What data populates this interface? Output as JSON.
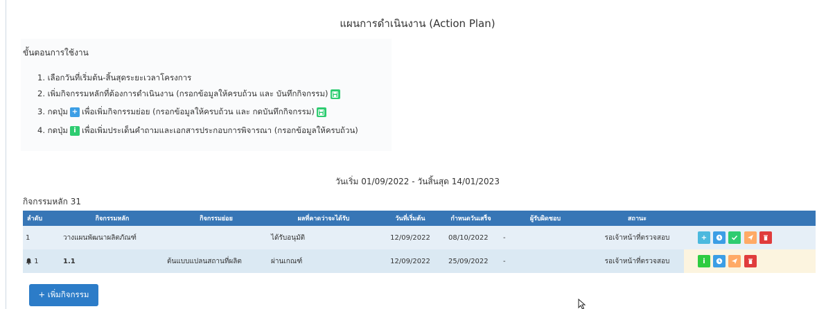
{
  "page": {
    "title": "แผนการดำเนินงาน (Action Plan)"
  },
  "instructions": {
    "heading": "ขั้นตอนการใช้งาน",
    "step1": "1. เลือกวันที่เริ่มต้น-สิ้นสุดระยะเวลาโครงการ",
    "step2": "2. เพิ่มกิจกรรมหลักที่ต้องการดำเนินงาน (กรอกข้อมูลให้ครบถ้วน และ บันทึกกิจกรรม)",
    "step3_prefix": "3. กดปุ่ม",
    "step3_suffix": "เพื่อเพิ่มกิจกรรมย่อย (กรอกข้อมูลให้ครบถ้วน และ กดบันทึกกิจกรรม)",
    "step4_prefix": "4. กดปุ่ม",
    "step4_suffix": "เพื่อเพิ่มประเด็นคำถามและเอกสารประกอบการพิจารณา (กรอกข้อมูลให้ครบถ้วน)",
    "icon_save": "floppy-disk-icon",
    "icon_plus": "plus-icon",
    "icon_info": "info-icon"
  },
  "date_range": "วันเริ่ม 01/09/2022 - วันสิ้นสุด 14/01/2023",
  "main_activity_count": "กิจกรรมหลัก 31",
  "table": {
    "headers": {
      "no": "ลำดับ",
      "main": "กิจกรรมหลัก",
      "sub": "กิจกรรมย่อย",
      "expected": "ผลที่คาดว่าจะได้รับ",
      "start": "วันที่เริ่มต้น",
      "due": "กำหนดวันเสร็จ",
      "owner": "ผู้รับผิดชอบ",
      "status": "สถานะ"
    },
    "rows": [
      {
        "no": "1",
        "main": "วางแผนพัฒนาผลิตภัณฑ์",
        "sub": "",
        "expected": "ได้รับอนุมัติ",
        "start": "12/09/2022",
        "due": "08/10/2022",
        "owner": "-",
        "status": "รอเจ้าหน้าที่ตรวจสอบ"
      },
      {
        "no": "1",
        "main": "1.1",
        "sub": "ต้นแบบแปลนสถานที่ผลิต",
        "expected": "ผ่านเกณฑ์",
        "start": "12/09/2022",
        "due": "25/09/2022",
        "owner": "-",
        "status": "รอเจ้าหน้าที่ตรวจสอบ"
      }
    ]
  },
  "add_button": "+ เพิ่มกิจกรรม",
  "colors": {
    "header": "#3776b6",
    "primary_button": "#2c7cc8",
    "info": "#4bb9de",
    "success": "#2ecc71",
    "warning": "#ffaa66",
    "danger": "#e03c3c"
  }
}
